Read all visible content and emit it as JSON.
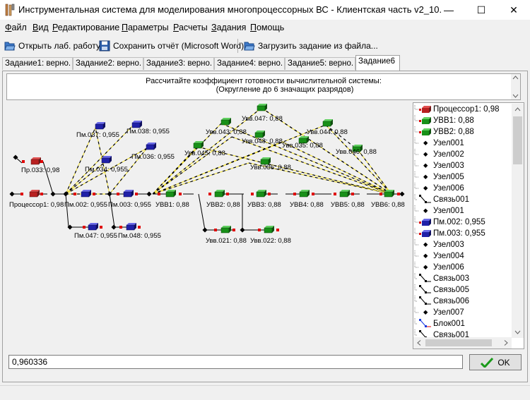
{
  "window": {
    "title": "Инструментальная система для моделирования многопроцессорных ВС - Клиентская часть v2_10.",
    "minimize_glyph": "—",
    "maximize_glyph": "☐",
    "close_glyph": "✕"
  },
  "menu": [
    {
      "label": "Файл",
      "key": "Ф"
    },
    {
      "label": "Вид",
      "key": "В"
    },
    {
      "label": "Редактирование",
      "key": "Р"
    },
    {
      "label": "Параметры",
      "key": "П"
    },
    {
      "label": "Расчеты",
      "key": "Р"
    },
    {
      "label": "Задания",
      "key": "З"
    },
    {
      "label": "Помощь",
      "key": "П"
    }
  ],
  "toolbar": {
    "open_label": "Открыть лаб. работу",
    "save_label": "Сохранить отчёт (Microsoft Word)",
    "load_label": "Загрузить задание из файла..."
  },
  "tabs": [
    {
      "label": "Задание1: верно."
    },
    {
      "label": "Задание2: верно."
    },
    {
      "label": "Задание3: верно."
    },
    {
      "label": "Задание4: верно."
    },
    {
      "label": "Задание5: верно."
    },
    {
      "label": "Задание6",
      "active": true
    }
  ],
  "question": {
    "line1": "Рассчитайте коэффициент готовности вычислительной системы:",
    "line2": "(Округление до 6 значащих разрядов)"
  },
  "diagram": {
    "labels": {
      "proc1": "Процессор1: 0,98",
      "pr033": "Пр.033: 0,98",
      "pm002": "Пм.002: 0,955",
      "pm003": "Пм.003: 0,955",
      "pm037": "Пм.037: 0,955",
      "pm038": "Пм.038: 0,955",
      "pm034": "Пм.034: 0,955",
      "pm036": "Пм.036: 0,955",
      "pm047": "Пм.047: 0,955",
      "pm048": "Пм.048: 0,955",
      "uvv1": "УВВ1: 0,88",
      "uvv2": "УВВ2: 0,88",
      "uvv3": "УВВ3: 0,88",
      "uvv4": "УВВ4: 0,88",
      "uvv5": "УВВ5: 0,88",
      "uvv6": "УВВ6: 0,88",
      "uv047": "Увв.047: 0,88",
      "uv043": "Увв.043: 0,88",
      "uv044": "Увв.044: 0,88",
      "uv045": "Увв.045: 0,88",
      "uv048": "Увв.048: 0,88",
      "uv035": "Увв.035: 0,88",
      "uv046": "Увв.046: 0,88",
      "uv036": "Увв.036: 0,88",
      "uv021": "Увв.021: 0,88",
      "uv022": "Увв.022: 0,88"
    }
  },
  "tree": {
    "items": [
      {
        "label": "Процессор1: 0,98",
        "icon": "processor-icon"
      },
      {
        "label": "УВВ1: 0,88",
        "icon": "io-device-icon"
      },
      {
        "label": "УВВ2: 0,88",
        "icon": "io-device-icon"
      },
      {
        "label": "Узел001",
        "icon": "node-icon"
      },
      {
        "label": "Узел002",
        "icon": "node-icon"
      },
      {
        "label": "Узел003",
        "icon": "node-icon"
      },
      {
        "label": "Узел005",
        "icon": "node-icon"
      },
      {
        "label": "Узел006",
        "icon": "node-icon"
      },
      {
        "label": "Связь001",
        "icon": "link-icon"
      },
      {
        "label": "Узел001",
        "icon": "node-icon"
      },
      {
        "label": "Пм.002: 0,955",
        "icon": "memory-icon"
      },
      {
        "label": "Пм.003: 0,955",
        "icon": "memory-icon"
      },
      {
        "label": "Узел003",
        "icon": "node-icon"
      },
      {
        "label": "Узел004",
        "icon": "node-icon"
      },
      {
        "label": "Узел006",
        "icon": "node-icon"
      },
      {
        "label": "Связь003",
        "icon": "link-icon"
      },
      {
        "label": "Связь005",
        "icon": "link-icon"
      },
      {
        "label": "Связь006",
        "icon": "link-icon"
      },
      {
        "label": "Узел007",
        "icon": "node-icon"
      },
      {
        "label": "Блок001",
        "icon": "block-icon"
      },
      {
        "label": "Связь001",
        "icon": "link-icon"
      }
    ]
  },
  "answer": {
    "value": "0,960336",
    "ok_label": "OK"
  }
}
